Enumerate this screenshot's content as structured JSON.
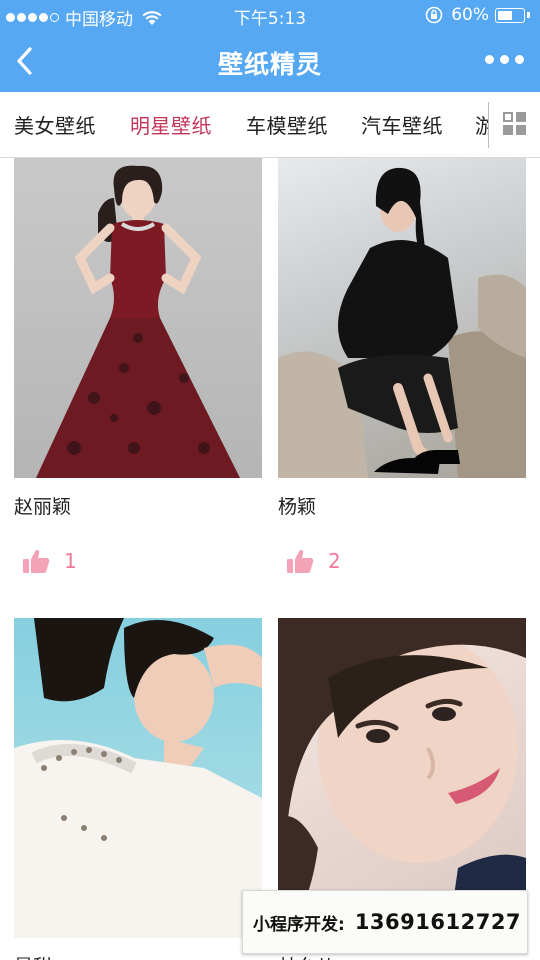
{
  "status_bar": {
    "carrier": "中国移动",
    "time": "下午5:13",
    "battery": "60%",
    "battery_level": 0.6
  },
  "nav": {
    "title": "壁纸精灵"
  },
  "tabs": [
    {
      "label": "美女壁纸",
      "active": false
    },
    {
      "label": "明星壁纸",
      "active": true
    },
    {
      "label": "车模壁纸",
      "active": false
    },
    {
      "label": "汽车壁纸",
      "active": false
    },
    {
      "label": "游",
      "active": false
    }
  ],
  "cards": [
    {
      "name": "赵丽颖",
      "likes": "1"
    },
    {
      "name": "杨颖",
      "likes": "2"
    },
    {
      "name": "景甜",
      "likes": ""
    },
    {
      "name": "林允儿",
      "likes": ""
    }
  ],
  "banner": {
    "label": "小程序开发:",
    "phone": "13691612727"
  },
  "colors": {
    "primary": "#56a8f2",
    "active_tab": "#c2365a",
    "like": "#ef7a9a"
  }
}
